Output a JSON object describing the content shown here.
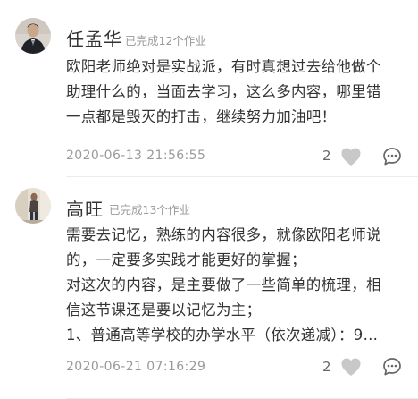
{
  "comments": [
    {
      "username": "任孟华",
      "meta": "已完成12个作业",
      "body_lines": [
        "欧阳老师绝对是实战派，有时真想过去给他做个",
        "助理什么的，当面去学习，这么多内容，哪里错",
        "一点都是毁灭的打击，继续努力加油吧！"
      ],
      "timestamp": "2020-06-13 21:56:55",
      "likes": "2",
      "avatar_icon": "person-in-dark-suit-avatar",
      "like_icon": "heart-icon",
      "reply_icon": "comment-bubble-icon"
    },
    {
      "username": "高旺",
      "meta": "已完成13个作业",
      "body_lines": [
        "需要去记忆，熟练的内容很多，就像欧阳老师说",
        "的，一定要多实践才能更好的掌握；",
        "对这次的内容，是主要做了一些简单的梳理，相",
        "信这节课还是要以记忆为主；",
        "1、普通高等学校的办学水平（依次递减）：9…"
      ],
      "timestamp": "2020-06-21 07:16:29",
      "likes": "2",
      "avatar_icon": "person-standing-photo-avatar",
      "like_icon": "heart-icon",
      "reply_icon": "comment-bubble-icon"
    }
  ],
  "colors": {
    "text_primary": "#333333",
    "text_secondary": "#9a9a9a",
    "icon_gray": "#bdbdbd",
    "divider": "#ececec"
  }
}
